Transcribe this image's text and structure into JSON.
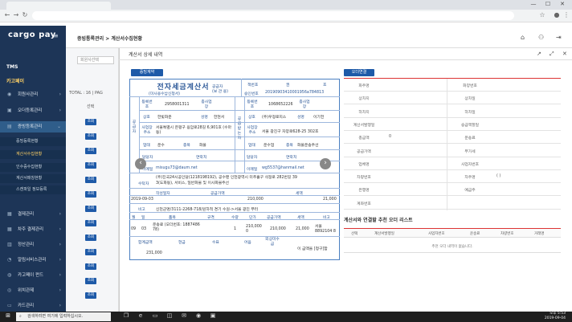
{
  "browser": {
    "tab_title": "",
    "address": "",
    "minimize": "—",
    "maximize": "☐",
    "close": "✕"
  },
  "app": {
    "logo": "cargo pay",
    "breadcrumb": "증빙통록관리 > 계산서수집현황",
    "sidebar_heading": "TMS",
    "sidebar_group": "카고페이",
    "menu": [
      {
        "label": "회원사관리"
      },
      {
        "label": "오더등록관리"
      },
      {
        "label": "증빙등록관리"
      }
    ],
    "submenu": [
      {
        "label": "증빙등록현황"
      },
      {
        "label": "계산서수집현황"
      },
      {
        "label": "인수증수집현황"
      },
      {
        "label": "계산서매칭현황"
      },
      {
        "label": "스캔파일 정보등록"
      }
    ],
    "menu2": [
      {
        "label": "결제관리"
      },
      {
        "label": "차주 결제관리"
      },
      {
        "label": "정산관리"
      },
      {
        "label": "알림서비스관리"
      },
      {
        "label": "카고페이 펀드"
      },
      {
        "label": "위치관제"
      },
      {
        "label": "카드관리"
      }
    ]
  },
  "list": {
    "search_placeholder": "회원사선택",
    "total": "TOTAL : 16",
    "page": "PAG",
    "col_select": "선택",
    "row_button": "조회"
  },
  "modal": {
    "title": "계산서 상세 내역",
    "evidence_btn": "증빙계약",
    "order_btn": "오더연결"
  },
  "invoice": {
    "title": "전자세금계산서",
    "sub1": "공급자",
    "sub2": "(보 관 용)",
    "sub3": "(미사용수납신청서)",
    "book_no": "책번호",
    "book_vol": "권",
    "book_ho": "호",
    "approval_label": "승인번호",
    "approval_no": "20190903410001956a784813",
    "supplier_side": "공급자",
    "buyer_side": "공급받는자",
    "reg_no_label": "등록번호",
    "sub_biz_label": "종사업장",
    "supplier_reg_no": "2958001311",
    "buyer_reg_no": "1068652226",
    "company_label": "상호",
    "name_label": "성명",
    "supplier_company": "한빛화운",
    "supplier_name": "한현서",
    "buyer_company": "(주)우정로지스",
    "buyer_name": "이기헌",
    "addr_label": "사업장주소",
    "supplier_addr": "서울특별시 은평구 응암로28길 6,901호 (수마동)",
    "buyer_addr": "서울 광진구 자양로628-25 302호",
    "type_label": "업태",
    "item_label": "종목",
    "supplier_type": "운수",
    "supplier_item": "화물",
    "buyer_type": "운수업",
    "buyer_item": "화물운송주선",
    "person_label": "담당자",
    "contact_label": "연락처",
    "email_label": "이메일",
    "supplier_email": "misugu73@daum.net",
    "buyer_email": "wg5537@hanmail.net",
    "note_label": "수탁자",
    "note": "(주)진국24시공인당(1218198192), 공수팬 인천광역시 미추홀구 석정로 282번길 39 3(도화동), 서비스, 일반화물 및 이사화물주선",
    "date_label": "작성일자",
    "supply_label": "공급가액",
    "tax_label": "세액",
    "date": "2019-09-03",
    "supply_amount": "210,000",
    "tax_amount": "21,000",
    "remark_label": "비고",
    "remark": "신천군명/3111-2268-718/원하적 경기 수원->서울 광진 부터",
    "item_headers": [
      "월",
      "일",
      "품목",
      "규격",
      "수량",
      "단가",
      "공급가액",
      "세액",
      "비고"
    ],
    "item_row": [
      "09",
      "03",
      "운송료 (오더번호: 1887486 78)",
      "",
      "1",
      "210,000 0",
      "210,000",
      "21,000",
      "서울8892104 8"
    ],
    "total_label": "합계금액",
    "cash_label": "현금",
    "check_label": "수표",
    "bill_label": "어음",
    "credit_label": "외상미수금",
    "total_amount": "231,000",
    "claim": "이 금액을 [청구]함"
  },
  "info": {
    "rows": [
      [
        "화주명",
        "",
        "화양번호",
        ""
      ],
      [
        "상차지",
        "",
        "상차일",
        ""
      ],
      [
        "하차지",
        "",
        "하차일",
        ""
      ],
      [
        "계산서발행일",
        "",
        "승급액할일",
        ""
      ],
      [
        "총금액",
        "0",
        "운송료",
        ""
      ],
      [
        "공급가액",
        "",
        "부가세",
        ""
      ],
      [
        "업체명",
        "",
        "사업자번호",
        ""
      ],
      [
        "차량번호",
        "",
        "차주명",
        "( )"
      ],
      [
        "은행명",
        "",
        "예금주",
        ""
      ],
      [
        "계좌번호",
        "",
        "",
        ""
      ]
    ]
  },
  "recommend": {
    "title": "계산서와 연결할 추천 오더 리스트",
    "headers": [
      "선택",
      "계산서발행일",
      "사업자번호",
      "운송료",
      "차량번호",
      "거래명"
    ],
    "empty": "추천 오더 내역이 없습니다."
  },
  "taskbar": {
    "search": "검색하려면 여기에 입력하십시오.",
    "time": "오후 5:53",
    "date": "2019-09-04"
  }
}
